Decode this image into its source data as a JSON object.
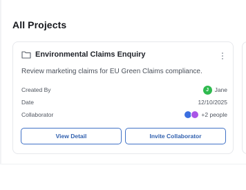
{
  "section": {
    "title": "All Projects"
  },
  "project": {
    "icon": "folder-icon",
    "title": "Environmental Claims Enquiry",
    "menu_icon": "more-vertical-icon",
    "description": "Review marketing claims for EU Green Claims compliance.",
    "created_by_label": "Created By",
    "created_by_initial": "J",
    "created_by_name": "Jane",
    "date_label": "Date",
    "date_value": "12/10/2025",
    "collaborator_label": "Collaborator",
    "collaborator_more": "+2 people",
    "view_button": "View Detail",
    "invite_button": "Invite Collaborator"
  },
  "colors": {
    "accent": "#3f71c6",
    "avatar_green": "#2fba4f",
    "collab_blue": "#3b6fe0",
    "collab_purple": "#a955e7"
  }
}
